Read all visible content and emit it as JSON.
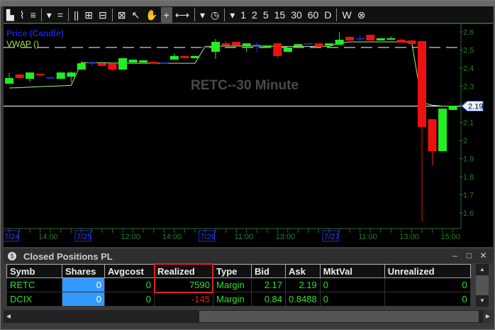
{
  "toolbar": {
    "items": [
      "bar-chart",
      "line-chart",
      "studies",
      "▾",
      "=",
      "||",
      "⊞",
      "⊟",
      "⊠",
      "↖",
      "✋",
      "+",
      "⟷",
      "▾",
      "◷",
      "▾",
      "1",
      "2",
      "5",
      "15",
      "30",
      "60",
      "D",
      "W",
      "⊗"
    ]
  },
  "chart": {
    "title": "RETC--30 Minute",
    "legend_price": "Price (Candle)",
    "legend_vwap": "VWAP ()",
    "last_price_label": "2.19",
    "last_price": 2.19,
    "dashed_level": 2.514,
    "colors": {
      "up": "#22ee22",
      "down": "#ee1111",
      "doji": "#1a3aff",
      "vwap": "#aaf07a",
      "axis": "#2a6a2a"
    },
    "y_ticks": [
      "2.6",
      "2.5",
      "2.4",
      "2.3",
      "2.2",
      "2.1",
      "2",
      "1.9",
      "1.8",
      "1.7",
      "1.6"
    ],
    "y_range": [
      1.5,
      2.63
    ],
    "x_labels": [
      {
        "t": "7/24",
        "date": true,
        "i": 0
      },
      {
        "t": "14:00",
        "i": 3.3
      },
      {
        "t": "7/25",
        "date": true,
        "i": 7
      },
      {
        "t": "12:00",
        "i": 11.3
      },
      {
        "t": "14:00",
        "i": 15.3
      },
      {
        "t": "7/26",
        "date": true,
        "i": 19
      },
      {
        "t": "11:00",
        "i": 22.3
      },
      {
        "t": "13:00",
        "i": 26.3
      },
      {
        "t": "7/27",
        "date": true,
        "i": 31
      },
      {
        "t": "11:00",
        "i": 34.3
      },
      {
        "t": "13:00",
        "i": 38.3
      },
      {
        "t": "15:00",
        "i": 42.3
      }
    ],
    "candles": [
      [
        2.314,
        2.345,
        2.373,
        2.314
      ],
      [
        2.365,
        2.345,
        2.365,
        2.345
      ],
      [
        2.341,
        2.376,
        2.376,
        2.325
      ],
      [
        2.369,
        2.361,
        2.369,
        2.361
      ],
      [
        2.349,
        2.349,
        2.353,
        2.349
      ],
      [
        2.341,
        2.376,
        2.376,
        2.341
      ],
      [
        2.353,
        2.376,
        2.38,
        2.322
      ],
      [
        2.392,
        2.427,
        2.44,
        2.392
      ],
      [
        2.431,
        2.431,
        2.44,
        2.41
      ],
      [
        2.427,
        2.412,
        2.44,
        2.412
      ],
      [
        2.427,
        2.392,
        2.427,
        2.385
      ],
      [
        2.392,
        2.455,
        2.455,
        2.392
      ],
      [
        2.431,
        2.447,
        2.447,
        2.431
      ],
      [
        2.431,
        2.443,
        2.443,
        2.431
      ],
      [
        2.435,
        2.424,
        2.435,
        2.424
      ],
      [
        2.431,
        2.431,
        2.431,
        2.431
      ],
      [
        2.447,
        2.467,
        2.48,
        2.447
      ],
      [
        2.467,
        2.455,
        2.467,
        2.455
      ],
      [
        2.455,
        2.467,
        2.467,
        2.455
      ],
      [
        2.518,
        2.518,
        2.518,
        2.518
      ],
      [
        2.49,
        2.545,
        2.561,
        2.451
      ],
      [
        2.537,
        2.525,
        2.55,
        2.525
      ],
      [
        2.545,
        2.525,
        2.545,
        2.525
      ],
      [
        2.522,
        2.537,
        2.537,
        2.49
      ],
      [
        2.53,
        2.53,
        2.541,
        2.49
      ],
      [
        2.514,
        2.525,
        2.525,
        2.514
      ],
      [
        2.537,
        2.467,
        2.537,
        2.455
      ],
      [
        2.49,
        2.514,
        2.514,
        2.49
      ],
      [
        2.522,
        2.533,
        2.533,
        2.522
      ],
      [
        2.537,
        2.537,
        2.537,
        2.537
      ],
      [
        2.537,
        2.518,
        2.537,
        2.518
      ],
      [
        2.525,
        2.537,
        2.537,
        2.525
      ],
      [
        2.529,
        2.557,
        2.6,
        2.529
      ],
      [
        2.573,
        2.553,
        2.573,
        2.553
      ],
      [
        2.565,
        2.565,
        2.58,
        2.555
      ],
      [
        2.584,
        2.553,
        2.584,
        2.553
      ],
      [
        2.553,
        2.565,
        2.565,
        2.553
      ],
      [
        2.557,
        2.565,
        2.575,
        2.557
      ],
      [
        2.557,
        2.541,
        2.565,
        2.541
      ],
      [
        2.553,
        2.533,
        2.553,
        2.533
      ],
      [
        2.549,
        2.075,
        2.549,
        1.553
      ],
      [
        2.118,
        1.941,
        2.118,
        1.863
      ],
      [
        1.941,
        2.176,
        2.176,
        1.941
      ],
      [
        2.169,
        2.192,
        2.192,
        2.169
      ]
    ],
    "vwap": [
      2.29,
      2.292,
      2.295,
      2.298,
      2.3,
      2.302,
      2.305,
      2.43,
      2.43,
      2.43,
      2.428,
      2.428,
      2.427,
      2.427,
      2.427,
      2.427,
      2.427,
      2.427,
      2.427,
      2.52,
      2.52,
      2.522,
      2.522,
      2.522,
      2.522,
      2.522,
      2.52,
      2.52,
      2.52,
      2.52,
      2.52,
      2.52,
      2.54,
      2.545,
      2.545,
      2.545,
      2.545,
      2.545,
      2.545,
      2.545,
      2.21,
      2.195,
      2.19,
      2.19
    ]
  },
  "panel": {
    "title": "Closed Positions PL",
    "min": "–",
    "max": "□",
    "close": "✕"
  },
  "table": {
    "headers": [
      "Symb",
      "Shares",
      "Avgcost",
      "Realized",
      "Type",
      "Bid",
      "Ask",
      "MktVal",
      "Unrealized"
    ],
    "rows": [
      [
        "RETC",
        "0",
        "0",
        "7590",
        "Margin",
        "2.17",
        "2.19",
        "0",
        "0"
      ],
      [
        "DCIX",
        "0",
        "0",
        "-145",
        "Margin",
        "0.84",
        "0.8488",
        "0",
        "0"
      ]
    ]
  }
}
